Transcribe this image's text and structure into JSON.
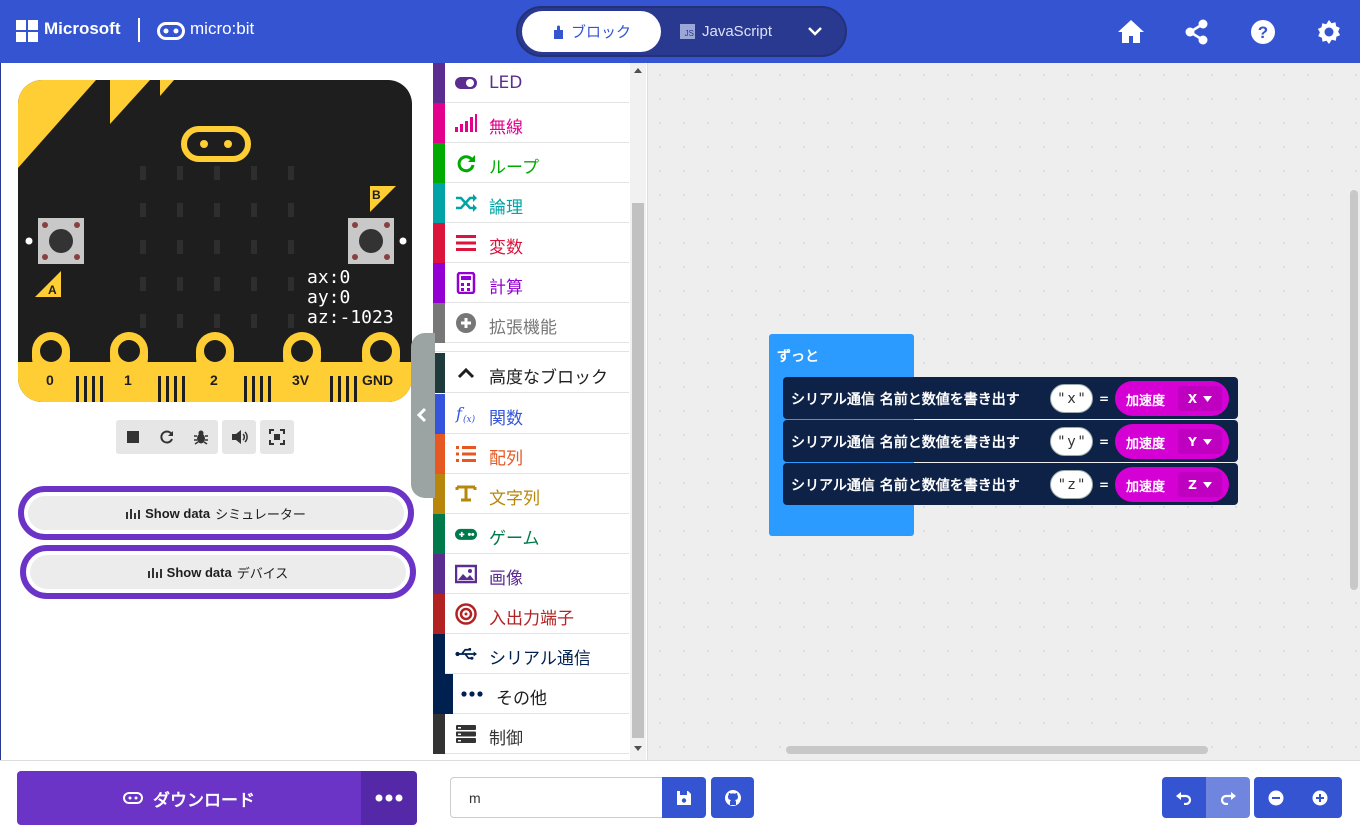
{
  "header": {
    "brand": "Microsoft",
    "product": "micro:bit",
    "tab_blocks": "ブロック",
    "tab_js": "JavaScript",
    "js_badge": "JS",
    "accent_color": "#3454d1"
  },
  "simulator": {
    "readout": [
      "ax:0",
      "ay:0",
      "az:-1023"
    ],
    "button_a": "A",
    "button_b": "B",
    "pins": [
      "0",
      "1",
      "2",
      "3V",
      "GND"
    ],
    "show_data_sim_bold": "Show data",
    "show_data_sim_label": "シミュレーター",
    "show_data_dev_bold": "Show data",
    "show_data_dev_label": "デバイス"
  },
  "toolbox": {
    "items": [
      {
        "label": "LED",
        "color": "#5c2d91",
        "icon": "toggle-icon"
      },
      {
        "label": "無線",
        "color": "#e3008c",
        "icon": "signal-icon"
      },
      {
        "label": "ループ",
        "color": "#00aa00",
        "icon": "loop-icon"
      },
      {
        "label": "論理",
        "color": "#00a4a6",
        "icon": "shuffle-icon"
      },
      {
        "label": "変数",
        "color": "#dc143c",
        "icon": "list-icon"
      },
      {
        "label": "計算",
        "color": "#9400d3",
        "icon": "calculator-icon"
      },
      {
        "label": "拡張機能",
        "color": "#777777",
        "icon": "plus-circle-icon"
      },
      {
        "label": "高度なブロック",
        "color": "#1e1e1e",
        "icon": "chevron-up-icon"
      },
      {
        "label": "関数",
        "color": "#3455db",
        "icon": "function-icon"
      },
      {
        "label": "配列",
        "color": "#e65722",
        "icon": "array-icon"
      },
      {
        "label": "文字列",
        "color": "#b8860b",
        "icon": "text-icon"
      },
      {
        "label": "ゲーム",
        "color": "#007a4b",
        "icon": "gamepad-icon"
      },
      {
        "label": "画像",
        "color": "#5c2d91",
        "icon": "image-icon"
      },
      {
        "label": "入出力端子",
        "color": "#b22222",
        "icon": "target-icon"
      },
      {
        "label": "シリアル通信",
        "color": "#002050",
        "icon": "usb-icon"
      },
      {
        "label": "その他",
        "color": "#002050",
        "icon": "more-dots-icon"
      },
      {
        "label": "制御",
        "color": "#333333",
        "icon": "server-icon"
      }
    ]
  },
  "workspace": {
    "forever_label": "ずっと",
    "serial_blocks": [
      {
        "label": "シリアル通信  名前と数値を書き出す",
        "name": "x",
        "eq": "=",
        "accel": "加速度",
        "axis": "X"
      },
      {
        "label": "シリアル通信  名前と数値を書き出す",
        "name": "y",
        "eq": "=",
        "accel": "加速度",
        "axis": "Y"
      },
      {
        "label": "シリアル通信  名前と数値を書き出す",
        "name": "z",
        "eq": "=",
        "accel": "加速度",
        "axis": "Z"
      }
    ]
  },
  "footer": {
    "download_label": "ダウンロード",
    "project_name": "m"
  }
}
